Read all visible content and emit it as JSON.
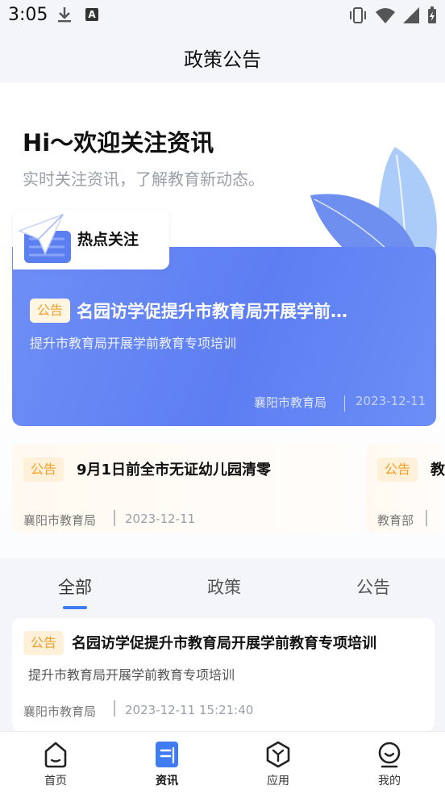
{
  "status_bar": {
    "time": "3:05"
  },
  "header": {
    "title": "政策公告"
  },
  "hero": {
    "greeting": "Hi～欢迎关注资讯",
    "subtitle": "实时关注资讯，了解教育新动态。"
  },
  "hot": {
    "label": "热点关注",
    "tag": "公告",
    "title": "名园访学促提升市教育局开展学前…",
    "desc": "提升市教育局开展学前教育专项培训",
    "source": "襄阳市教育局",
    "date": "2023-12-11"
  },
  "cards": [
    {
      "tag": "公告",
      "title": "9月1日前全市无证幼儿园清零",
      "source": "襄阳市教育局",
      "date": "2023-12-11"
    },
    {
      "tag": "公告",
      "title": "教",
      "source": "教育部",
      "date": ""
    }
  ],
  "tabs": [
    {
      "label": "全部",
      "active": true
    },
    {
      "label": "政策",
      "active": false
    },
    {
      "label": "公告",
      "active": false
    }
  ],
  "list": [
    {
      "tag": "公告",
      "title": "名园访学促提升市教育局开展学前教育专项培训",
      "desc": "提升市教育局开展学前教育专项培训",
      "source": "襄阳市教育局",
      "datetime": "2023-12-11 15:21:40"
    }
  ],
  "nav": [
    {
      "label": "首页",
      "icon": "home-icon"
    },
    {
      "label": "资讯",
      "icon": "news-icon",
      "active": true
    },
    {
      "label": "应用",
      "icon": "apps-icon"
    },
    {
      "label": "我的",
      "icon": "profile-icon"
    }
  ],
  "colors": {
    "accent": "#3f7bf2",
    "tag_text": "#f0a029",
    "card_blue": "#5d7ef2"
  }
}
